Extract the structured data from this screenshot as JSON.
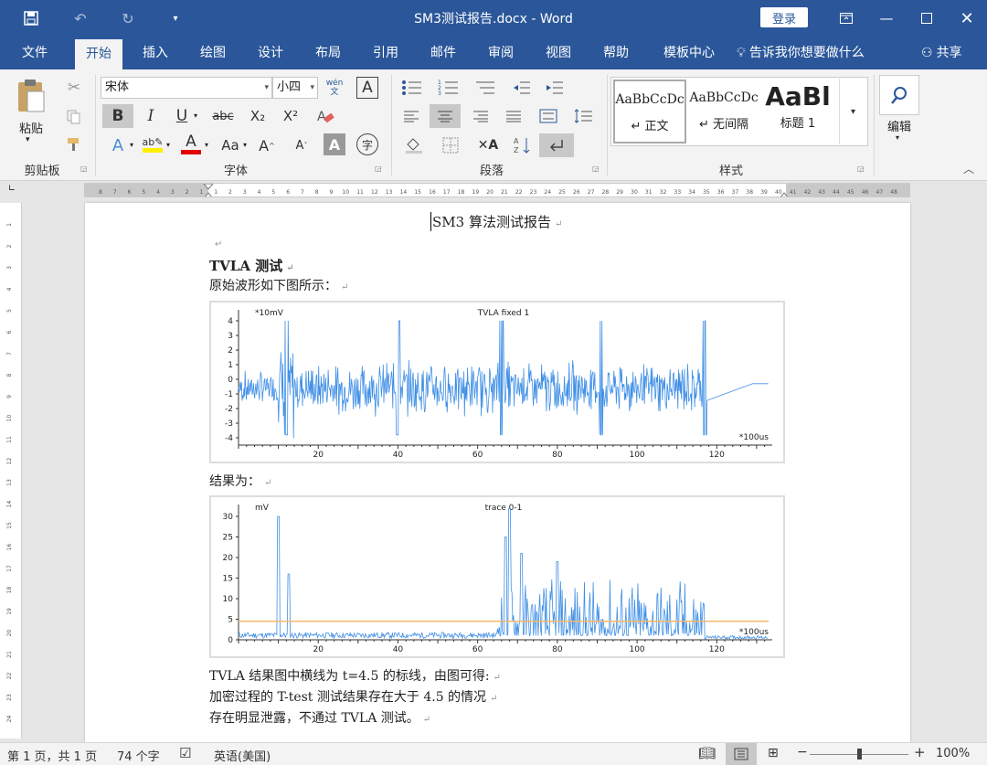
{
  "window": {
    "title": "SM3测试报告.docx  -  Word",
    "login": "登录"
  },
  "tabs": [
    "文件",
    "开始",
    "插入",
    "绘图",
    "设计",
    "布局",
    "引用",
    "邮件",
    "审阅",
    "视图",
    "帮助",
    "模板中心"
  ],
  "tell_me": "告诉我你想要做什么",
  "share": "共享",
  "ribbon": {
    "clipboard": {
      "paste": "粘贴",
      "label": "剪贴板"
    },
    "font": {
      "name": "宋体",
      "size": "小四",
      "pinyin": "wén\n文",
      "bold": "B",
      "italic": "I",
      "underline": "U",
      "strike": "abc",
      "sub": "X₂",
      "sup": "X²",
      "grow": "A",
      "shrink": "A",
      "case": "Aa",
      "label": "字体",
      "char_shade": "A",
      "enclose": "字"
    },
    "paragraph": {
      "label": "段落"
    },
    "styles": {
      "items": [
        {
          "preview": "AaBbCcDc",
          "name": "↵ 正文"
        },
        {
          "preview": "AaBbCcDc",
          "name": "↵ 无间隔"
        },
        {
          "preview": "AaBl",
          "name": "标题 1"
        }
      ],
      "label": "样式"
    },
    "editing": {
      "label": "编辑"
    }
  },
  "ruler": {
    "labels": [
      "8",
      "7",
      "6",
      "5",
      "4",
      "3",
      "2",
      "1",
      "1",
      "2",
      "3",
      "4",
      "5",
      "6",
      "7",
      "8",
      "9",
      "10",
      "11",
      "12",
      "13",
      "14",
      "15",
      "16",
      "17",
      "18",
      "19",
      "20",
      "21",
      "22",
      "23",
      "24",
      "25",
      "26",
      "27",
      "28",
      "29",
      "30",
      "31",
      "32",
      "33",
      "34",
      "35",
      "36",
      "37",
      "38",
      "39",
      "40",
      "41",
      "42",
      "43",
      "44",
      "45",
      "46",
      "47",
      "48"
    ],
    "vlabels": [
      "1",
      "2",
      "3",
      "4",
      "5",
      "6",
      "7",
      "8",
      "9",
      "10",
      "11",
      "12",
      "13",
      "14",
      "15",
      "16",
      "17",
      "18",
      "19",
      "20",
      "21",
      "22",
      "23",
      "24"
    ]
  },
  "document": {
    "title": "SM3 算法测试报告",
    "heading": "TVLA 测试",
    "intro": "原始波形如下图所示：",
    "result_label": "结果为：",
    "conclusion": [
      "TVLA 结果图中横线为 t=4.5 的标线，由图可得:",
      "加密过程的 T-test 测试结果存在大于 4.5 的情况",
      "存在明显泄露，不通过 TVLA 测试。"
    ]
  },
  "chart_data": [
    {
      "type": "line",
      "title": "TVLA fixed 1",
      "ylabel": "*10mV",
      "xlabel": "*100us",
      "xlim": [
        0,
        133
      ],
      "ylim": [
        -4.5,
        4.5
      ],
      "xticks": [
        20,
        40,
        60,
        80,
        100,
        120
      ],
      "yticks": [
        4,
        3,
        2,
        1,
        0,
        -1,
        -2,
        -3,
        -4
      ],
      "series_color": "#3f8fe6"
    },
    {
      "type": "line",
      "title": "trace 0-1",
      "ylabel": "mV",
      "xlabel": "*100us",
      "xlim": [
        0,
        133
      ],
      "ylim": [
        0,
        32
      ],
      "xticks": [
        20,
        40,
        60,
        80,
        100,
        120
      ],
      "yticks": [
        30,
        25,
        20,
        15,
        10,
        5,
        0
      ],
      "threshold": 4.5,
      "threshold_color": "#f5b76b",
      "series_color": "#3f8fe6"
    }
  ],
  "status": {
    "page": "第 1 页，共 1 页",
    "words": "74 个字",
    "lang": "英语(美国)",
    "zoom": "100%"
  }
}
